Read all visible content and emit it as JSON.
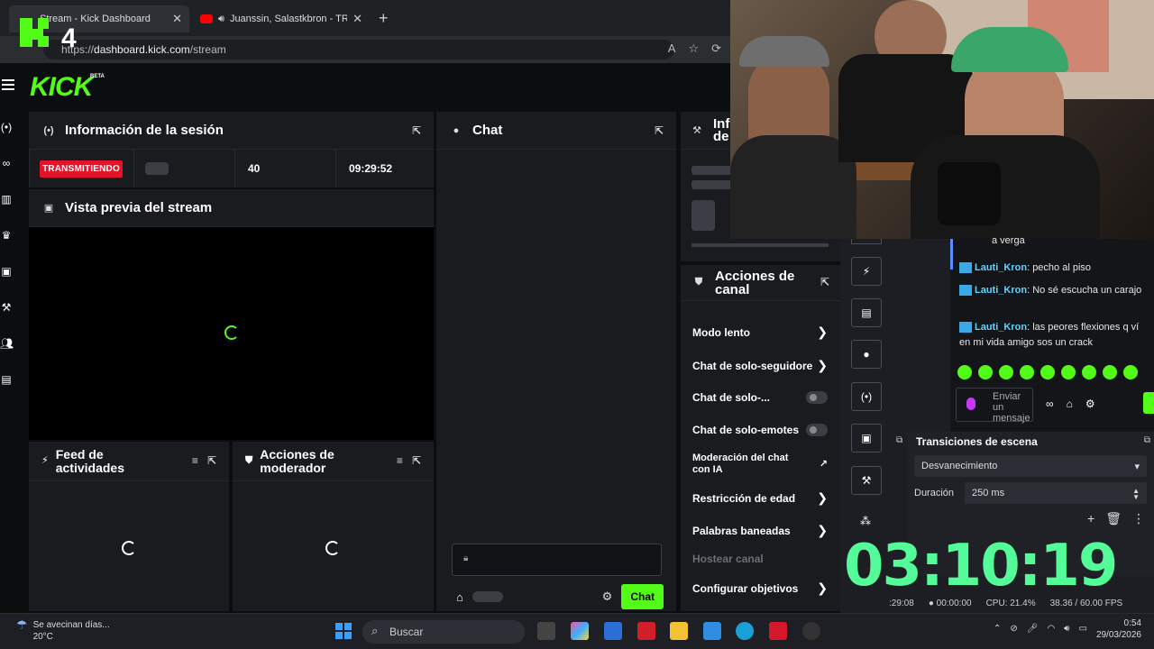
{
  "browser": {
    "tabs": [
      {
        "title": "Stream - Kick Dashboard"
      },
      {
        "title": "Juanssin, Salastkbron - TROPI"
      }
    ],
    "url_prefix": "https://",
    "url_domain": "dashboard.kick.com",
    "url_path": "/stream",
    "overlay_logo_text": "4"
  },
  "kick": {
    "logo": "KICK",
    "logo_badge": "BETA",
    "accent": "#53fc18"
  },
  "session": {
    "title": "Información de la sesión",
    "status": "TRANSMITIENDO",
    "viewers": "40",
    "duration": "09:29:52"
  },
  "preview": {
    "title": "Vista previa del stream"
  },
  "feed": {
    "title": "Feed de actividades"
  },
  "modactions": {
    "title": "Acciones de moderador"
  },
  "chat": {
    "title": "Chat",
    "send_label": "Chat"
  },
  "info_panel": {
    "title": "Inf de"
  },
  "channel_actions": {
    "title": "Acciones de canal",
    "items": [
      "Modo lento",
      "Chat de solo-seguidore",
      "Chat de solo-...",
      "Chat de solo-emotes",
      "Moderación del chat con IA",
      "Restricción de edad",
      "Palabras baneadas",
      "Hostear canal",
      "Configurar objetivos"
    ]
  },
  "obs_chat": {
    "partial_top": "a verga",
    "messages": [
      {
        "user": "Lauti_Kron",
        "text": "pecho al piso"
      },
      {
        "user": "Lauti_Kron",
        "text": "No sé escucha un carajo"
      },
      {
        "user": "Lauti_Kron",
        "text": "las peores flexiones q ví en mi vida amigo sos un crack"
      }
    ],
    "input_placeholder": "Enviar un mensaje"
  },
  "obs": {
    "transitions_title": "Transiciones de escena",
    "transition": "Desvanecimiento",
    "duration_label": "Duración",
    "duration_value": "250 ms",
    "clock": "03:10:19",
    "status": {
      "live_time": ":29:08",
      "rec_time": "00:00:00",
      "cpu": "CPU: 21.4%",
      "fps": "38.36 / 60.00 FPS"
    }
  },
  "taskbar": {
    "weather_text": "Se avecinan días...",
    "temp": "20°C",
    "search_placeholder": "Buscar",
    "time": "0:54",
    "date": "29/03/2026"
  }
}
